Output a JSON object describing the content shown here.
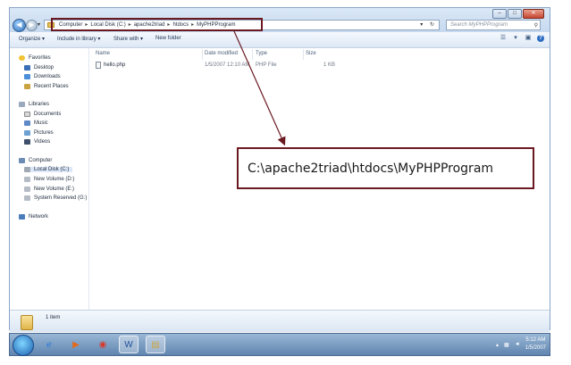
{
  "address": {
    "crumbs": [
      "Computer",
      "Local Disk (C:)",
      "apache2triad",
      "htdocs",
      "MyPHPProgram"
    ],
    "separator": "▸"
  },
  "search": {
    "placeholder": "Search MyPHPProgram"
  },
  "toolbar": {
    "organize": "Organize ▾",
    "include": "Include in library ▾",
    "share": "Share with ▾",
    "new_folder": "New folder"
  },
  "sidebar": {
    "favorites": "Favorites",
    "desktop": "Desktop",
    "downloads": "Downloads",
    "recent": "Recent Places",
    "libraries": "Libraries",
    "documents": "Documents",
    "music": "Music",
    "pictures": "Pictures",
    "videos": "Videos",
    "computer": "Computer",
    "local_c": "Local Disk (C:)",
    "vol_d": "New Volume (D:)",
    "vol_e": "New Volume (E:)",
    "sys_g": "System Reserved (G:)",
    "network": "Network"
  },
  "columns": {
    "name": "Name",
    "date": "Date modified",
    "type": "Type",
    "size": "Size"
  },
  "file": {
    "name": "hello.php",
    "date": "1/5/2007 12:10 AM",
    "type": "PHP File",
    "size": "1 KB"
  },
  "status": {
    "items": "1 item"
  },
  "clock": {
    "time": "5:12 AM",
    "date": "1/5/2007"
  },
  "annotation": {
    "path": "C:\\apache2triad\\htdocs\\MyPHPProgram",
    "color": "#6b1a22"
  },
  "icons": [
    "back-arrow-icon",
    "forward-arrow-icon",
    "folder-icon",
    "refresh-icon",
    "search-icon",
    "star-icon",
    "php-file-icon",
    "windows-start-icon",
    "ie-icon",
    "media-player-icon",
    "chrome-icon",
    "word-icon",
    "explorer-icon"
  ]
}
